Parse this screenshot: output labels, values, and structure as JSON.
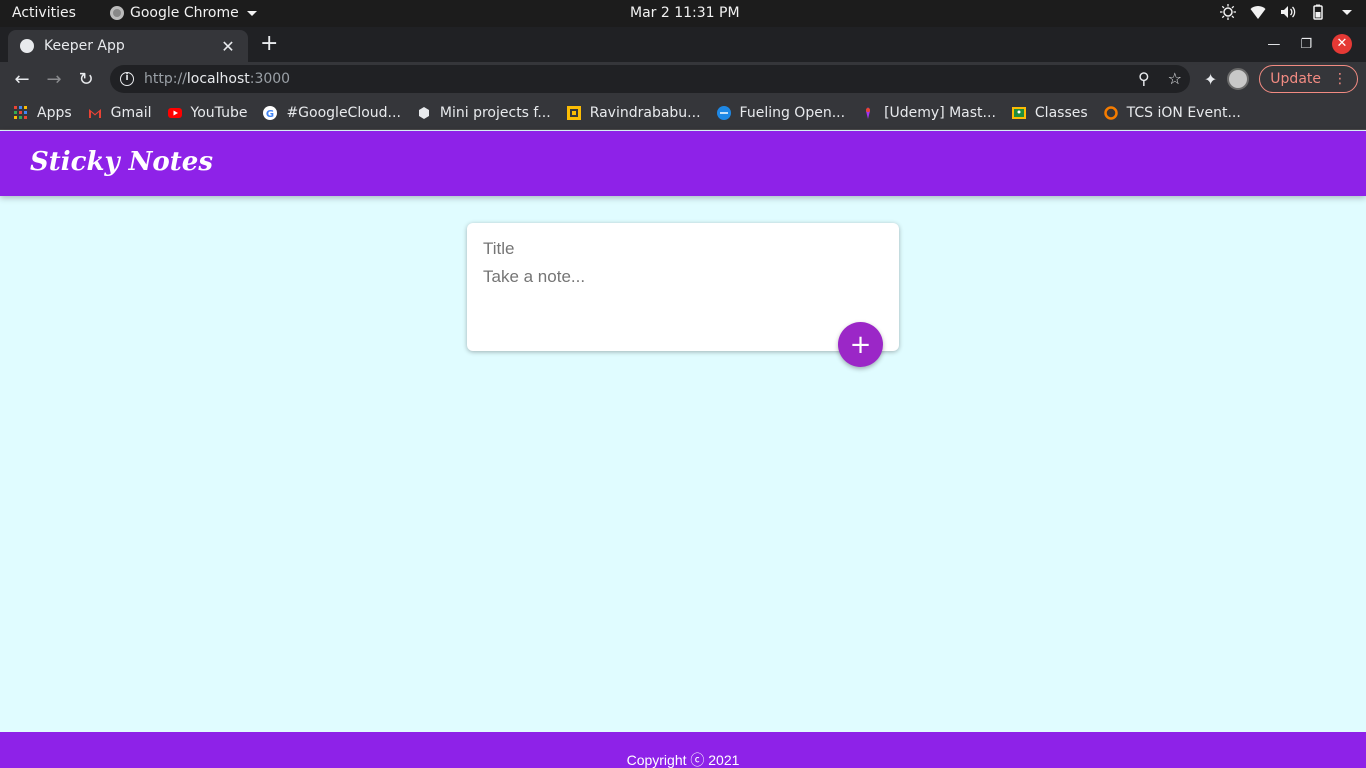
{
  "os_bar": {
    "activities": "Activities",
    "app_name": "Google Chrome",
    "clock": "Mar 2  11:31 PM"
  },
  "browser": {
    "tab_title": "Keeper App",
    "url_scheme": "http://",
    "url_host": "localhost",
    "url_port": ":3000",
    "update_label": "Update",
    "bookmarks": [
      {
        "label": "Apps",
        "icon": "apps-grid-icon",
        "color": "#4285f4"
      },
      {
        "label": "Gmail",
        "icon": "gmail-icon",
        "color": "#ea4335"
      },
      {
        "label": "YouTube",
        "icon": "youtube-icon",
        "color": "#ff0000"
      },
      {
        "label": "#GoogleCloud...",
        "icon": "google-icon",
        "color": "#ffffff"
      },
      {
        "label": "Mini projects f...",
        "icon": "cube-icon",
        "color": "#e8eaed"
      },
      {
        "label": "Ravindrababu...",
        "icon": "ravindrababu-icon",
        "color": "#fbbc04"
      },
      {
        "label": "Fueling Open...",
        "icon": "fueling-icon",
        "color": "#1e88e5"
      },
      {
        "label": "[Udemy] Mast...",
        "icon": "udemy-icon",
        "color": "#a435f0"
      },
      {
        "label": "Classes",
        "icon": "classroom-icon",
        "color": "#fbbc04"
      },
      {
        "label": "TCS iON Event...",
        "icon": "tcs-icon",
        "color": "#f57c00"
      }
    ]
  },
  "app": {
    "header_title": "Sticky Notes",
    "title_placeholder": "Title",
    "content_placeholder": "Take a note...",
    "add_label": "+",
    "footer": "Copyright ⓒ 2021",
    "colors": {
      "header": "#8e22e8",
      "background": "#e0fcff",
      "add_button": "#9b27c7"
    }
  }
}
